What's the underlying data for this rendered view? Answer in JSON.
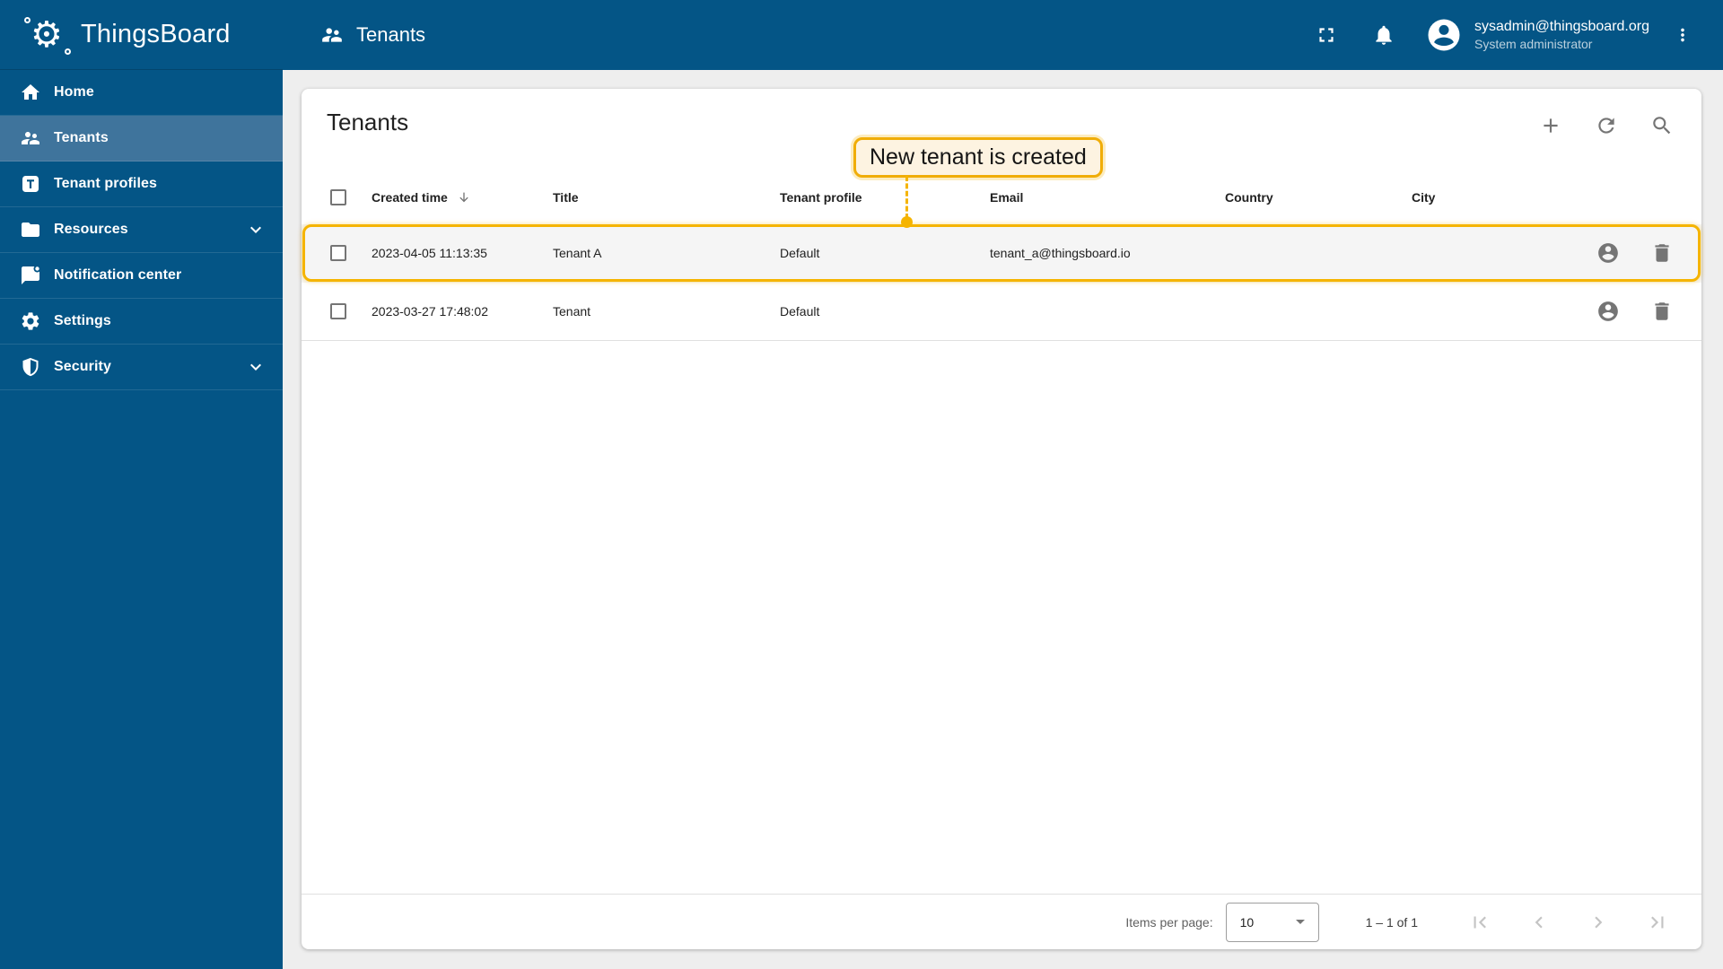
{
  "app": {
    "name": "ThingsBoard"
  },
  "topbar": {
    "breadcrumb": "Tenants",
    "user": {
      "email": "sysadmin@thingsboard.org",
      "role": "System administrator"
    }
  },
  "sidebar": {
    "items": [
      {
        "label": "Home",
        "selected": false
      },
      {
        "label": "Tenants",
        "selected": true
      },
      {
        "label": "Tenant profiles",
        "selected": false
      },
      {
        "label": "Resources",
        "selected": false,
        "expandable": true
      },
      {
        "label": "Notification center",
        "selected": false
      },
      {
        "label": "Settings",
        "selected": false
      },
      {
        "label": "Security",
        "selected": false,
        "expandable": true
      }
    ]
  },
  "page": {
    "title": "Tenants"
  },
  "callout": {
    "text": "New tenant is created"
  },
  "table": {
    "headers": {
      "created_time": "Created time",
      "title": "Title",
      "tenant_profile": "Tenant profile",
      "email": "Email",
      "country": "Country",
      "city": "City"
    },
    "rows": [
      {
        "created_time": "2023-04-05 11:13:35",
        "title": "Tenant A",
        "tenant_profile": "Default",
        "email": "tenant_a@thingsboard.io",
        "country": "",
        "city": "",
        "highlighted": true
      },
      {
        "created_time": "2023-03-27 17:48:02",
        "title": "Tenant",
        "tenant_profile": "Default",
        "email": "",
        "country": "",
        "city": "",
        "highlighted": false
      }
    ]
  },
  "pagination": {
    "items_per_page_label": "Items per page:",
    "items_per_page": "10",
    "range": "1 – 1 of 1"
  },
  "icons": {
    "logo": "thingsboard-gear-icon",
    "breadcrumb": "people-icon",
    "sidebar": [
      "home-icon",
      "people-icon",
      "tenant-profile-icon",
      "folder-icon",
      "notification-bubble-icon",
      "gear-icon",
      "shield-icon",
      "chevron-down-icon"
    ],
    "topbar": [
      "fullscreen-icon",
      "bell-icon",
      "avatar-icon",
      "more-vert-icon"
    ],
    "card_toolbar": [
      "add-icon",
      "refresh-icon",
      "search-icon"
    ],
    "row_actions": [
      "manage-users-icon",
      "delete-icon"
    ],
    "table": [
      "sort-desc-icon",
      "checkbox"
    ],
    "pagination": [
      "first-page-icon",
      "prev-page-icon",
      "next-page-icon",
      "last-page-icon"
    ]
  },
  "colors": {
    "primary": "#045586",
    "sidebar_selected": "#3f749c",
    "accent": "#f5b400",
    "callout_bg": "#fdf3e1",
    "content_bg": "#eeeeee",
    "row_highlight_bg": "#f5f5f5",
    "icon_gray": "#757575",
    "text": "#212121"
  }
}
